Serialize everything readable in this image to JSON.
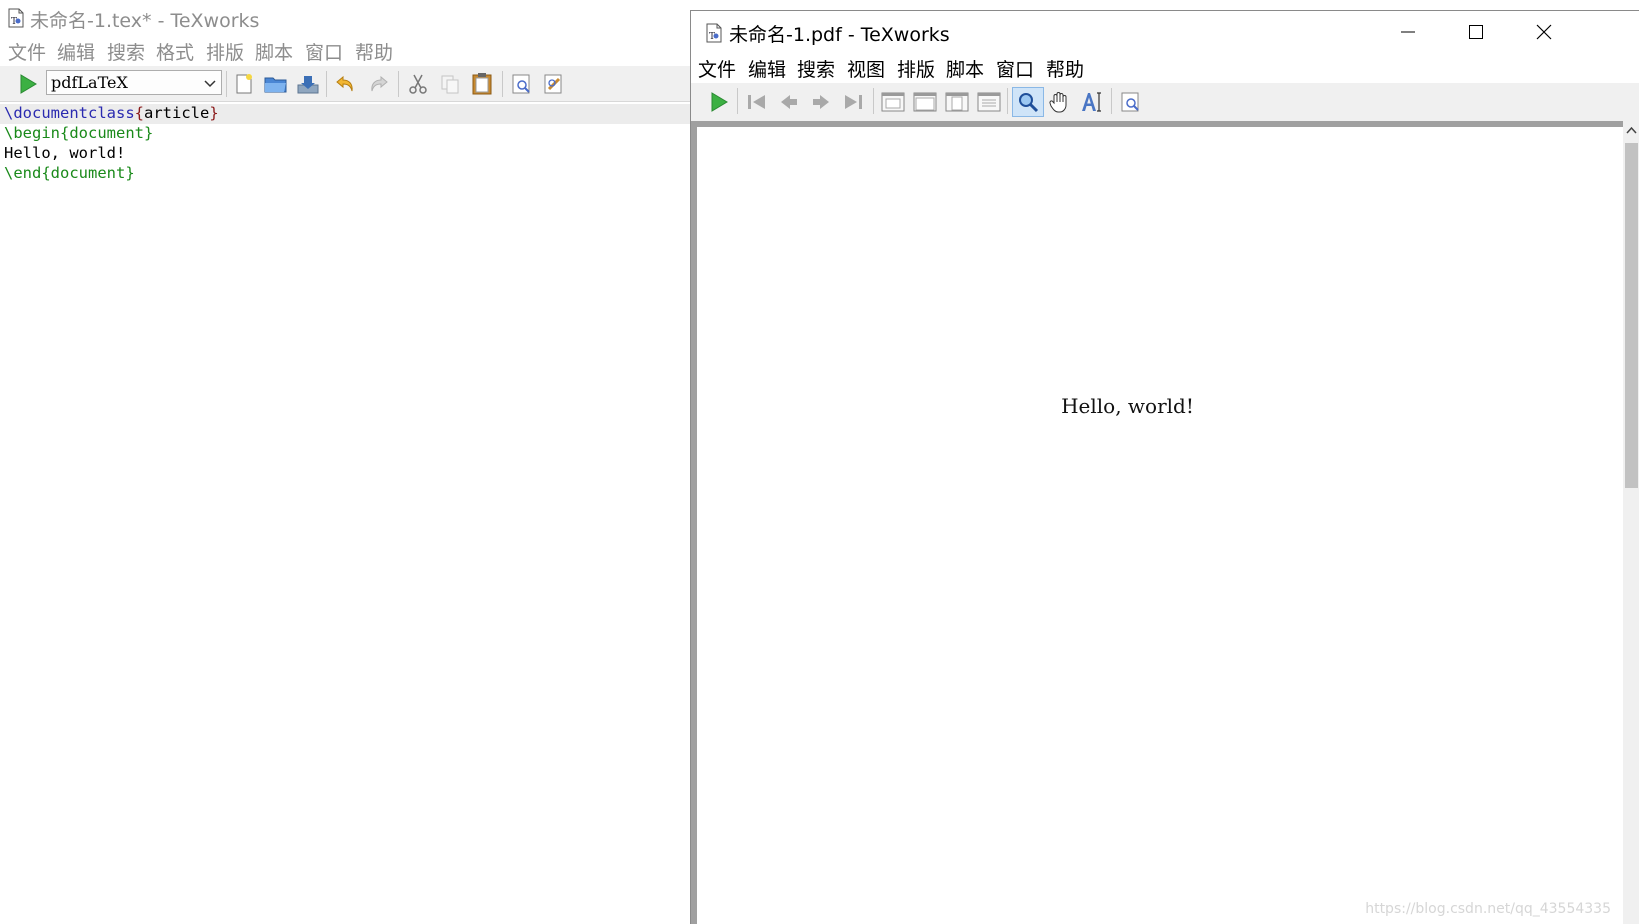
{
  "editor": {
    "title": "未命名-1.tex* - TeXworks",
    "menu": [
      "文件",
      "编辑",
      "搜索",
      "格式",
      "排版",
      "脚本",
      "窗口",
      "帮助"
    ],
    "engine": "pdfLaTeX",
    "code": [
      {
        "cmd": "\\documentclass",
        "open": "{",
        "arg": "article",
        "close": "}"
      },
      {
        "cmd": "\\begin",
        "open": "{",
        "arg": "document",
        "close": "}"
      },
      {
        "text": "Hello, world!"
      },
      {
        "cmd": "\\end",
        "open": "{",
        "arg": "document",
        "close": "}"
      }
    ]
  },
  "preview": {
    "title": "未命名-1.pdf - TeXworks",
    "menu": [
      "文件",
      "编辑",
      "搜索",
      "视图",
      "排版",
      "脚本",
      "窗口",
      "帮助"
    ],
    "page_text": "Hello, world!",
    "watermark": "https://blog.csdn.net/qq_43554335"
  },
  "icons": {
    "editor_toolbar": [
      "typeset-icon",
      "new-file-icon",
      "open-folder-icon",
      "save-icon",
      "undo-icon",
      "redo-icon",
      "cut-icon",
      "copy-icon",
      "paste-icon",
      "find-icon",
      "replace-icon"
    ],
    "preview_toolbar": [
      "typeset-icon",
      "first-page-icon",
      "prev-page-icon",
      "next-page-icon",
      "last-page-icon",
      "actual-size-icon",
      "fit-width-icon",
      "fit-window-icon",
      "fit-content-icon",
      "magnify-icon",
      "hand-scroll-icon",
      "select-text-icon",
      "find-icon"
    ]
  },
  "colors": {
    "command": "#2a2ab0",
    "argument": "#1a8a1a",
    "brace": "#8b1a1a",
    "typeset_green": "#3cb043",
    "active_tool": "#cfe4f8"
  }
}
